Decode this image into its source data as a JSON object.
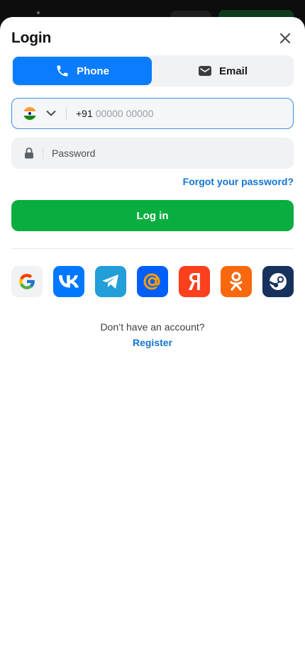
{
  "modal": {
    "title": "Login"
  },
  "tabs": [
    {
      "label": "Phone",
      "icon": "phone-icon",
      "active": true
    },
    {
      "label": "Email",
      "icon": "email-icon",
      "active": false
    }
  ],
  "phone": {
    "country_flag": "india-flag-icon",
    "dial_code": "+91",
    "placeholder": "00000 00000",
    "value": ""
  },
  "password": {
    "placeholder": "Password",
    "value": ""
  },
  "forgot_label": "Forgot your password?",
  "login_label": "Log in",
  "social": [
    {
      "name": "google",
      "icon": "google-icon",
      "bg": "#f1f2f4"
    },
    {
      "name": "vk",
      "icon": "vk-icon",
      "bg": "#0077ff"
    },
    {
      "name": "telegram",
      "icon": "telegram-icon",
      "bg": "#229ed9"
    },
    {
      "name": "mail",
      "icon": "mail-ru-icon",
      "bg": "#005ff9"
    },
    {
      "name": "yandex",
      "icon": "yandex-icon",
      "bg": "#fc3f1d"
    },
    {
      "name": "odnoklassniki",
      "icon": "odnoklassniki-icon",
      "bg": "#f7680f"
    },
    {
      "name": "steam",
      "icon": "steam-icon",
      "bg": "#1b3a66"
    }
  ],
  "signup": {
    "prompt": "Don’t have an account?",
    "register_label": "Register"
  },
  "colors": {
    "accent": "#0a7cff",
    "login_button": "#0aad3f",
    "link": "#1275d6"
  }
}
